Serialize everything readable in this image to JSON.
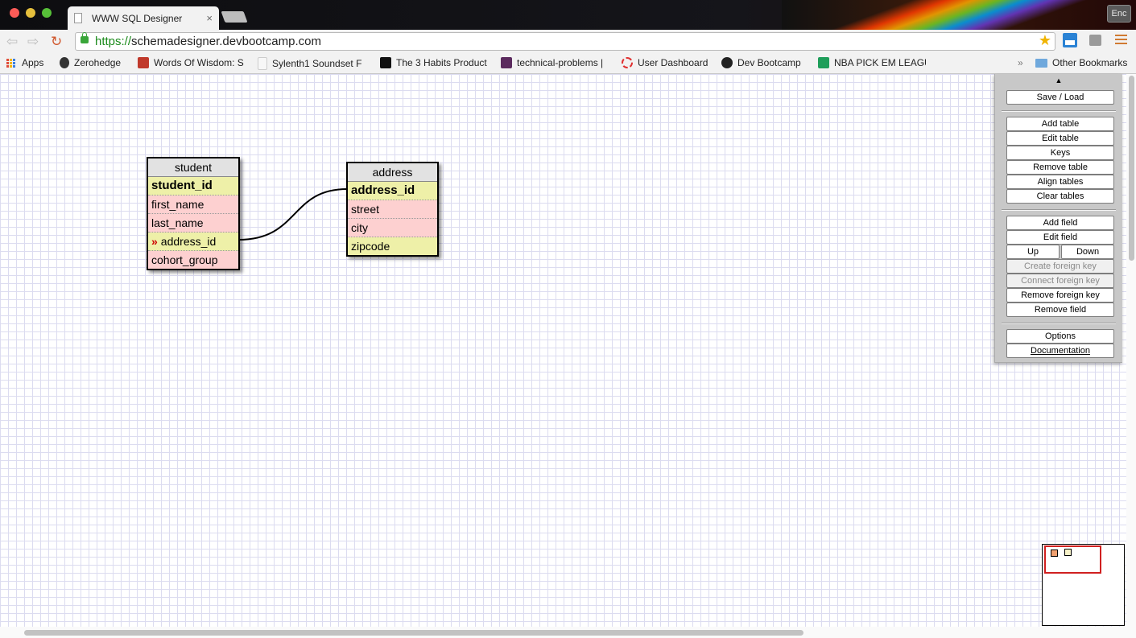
{
  "window": {
    "tab_title": "WWW SQL Designer",
    "tab_close": "×",
    "enc_label": "Enc"
  },
  "toolbar": {
    "url_scheme": "https://",
    "url_host": "schemadesigner.devbootcamp.com"
  },
  "bookmarks": {
    "items": [
      {
        "label": "Apps",
        "icon": "apps-grid-icon"
      },
      {
        "label": "Zerohedge",
        "icon": "zerohedge-icon"
      },
      {
        "label": "Words Of Wisdom: S",
        "icon": "chess-rook-icon"
      },
      {
        "label": "Sylenth1 Soundset F",
        "icon": "page-icon"
      },
      {
        "label": "The 3 Habits Product",
        "icon": "e-letter-icon"
      },
      {
        "label": "technical-problems |",
        "icon": "slack-icon"
      },
      {
        "label": "User Dashboard",
        "icon": "circle-icon"
      },
      {
        "label": "Dev Bootcamp",
        "icon": "github-icon"
      },
      {
        "label": "NBA PICK EM LEAGU",
        "icon": "sheets-icon"
      }
    ],
    "overflow": "»",
    "other": "Other Bookmarks"
  },
  "tables": {
    "student": {
      "name": "student",
      "fields": [
        "student_id",
        "first_name",
        "last_name",
        "address_id",
        "cohort_group"
      ]
    },
    "address": {
      "name": "address",
      "fields": [
        "address_id",
        "street",
        "city",
        "zipcode"
      ]
    }
  },
  "fk_marker": "»",
  "panel": {
    "toggle": "▲",
    "save_load": "Save / Load",
    "add_table": "Add table",
    "edit_table": "Edit table",
    "keys": "Keys",
    "remove_table": "Remove table",
    "align_tables": "Align tables",
    "clear_tables": "Clear tables",
    "add_field": "Add field",
    "edit_field": "Edit field",
    "up": "Up",
    "down": "Down",
    "create_foreign_key": "Create foreign key",
    "connect_foreign_key": "Connect foreign key",
    "remove_foreign_key": "Remove foreign key",
    "remove_field": "Remove field",
    "options": "Options",
    "documentation": "Documentation"
  }
}
